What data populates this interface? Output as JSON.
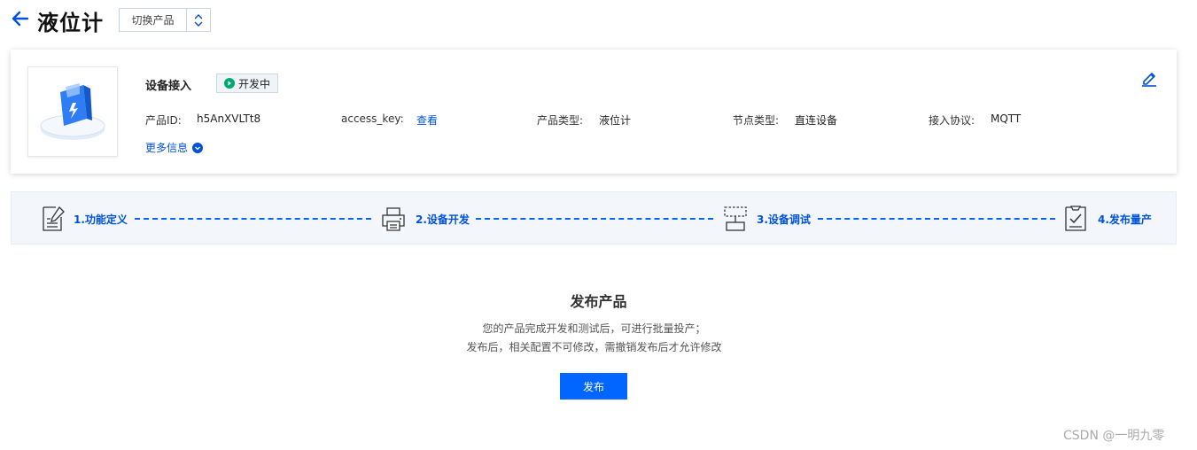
{
  "header": {
    "back_icon": "arrow-left-icon",
    "title": "液位计",
    "switch_label": "切换产品",
    "switch_icon": "chevron-updown-icon"
  },
  "product": {
    "section_title": "设备接入",
    "status": "开发中",
    "status_color": "#00a870",
    "fields": {
      "id_key": "产品ID:",
      "id_value": "h5AnXVLTt8",
      "access_key": "access_key:",
      "access_value": "查看",
      "type_key": "产品类型:",
      "type_value": "液位计",
      "node_key": "节点类型:",
      "node_value": "直连设备",
      "protocol_key": "接入协议:",
      "protocol_value": "MQTT"
    },
    "more_info": "更多信息",
    "edit_icon": "pencil-icon"
  },
  "steps": [
    {
      "label": "1.功能定义",
      "icon": "edit-document-icon"
    },
    {
      "label": "2.设备开发",
      "icon": "printer-icon"
    },
    {
      "label": "3.设备调试",
      "icon": "debug-device-icon"
    },
    {
      "label": "4.发布量产",
      "icon": "checklist-icon"
    }
  ],
  "release": {
    "title": "发布产品",
    "desc_line1": "您的产品完成开发和测试后，可进行批量投产；",
    "desc_line2": "发布后，相关配置不可修改，需撤销发布后才允许修改",
    "button": "发布"
  },
  "watermark": "CSDN @一明九零",
  "colors": {
    "accent": "#0052d9",
    "button": "#0066ff",
    "status_green": "#00a870"
  }
}
